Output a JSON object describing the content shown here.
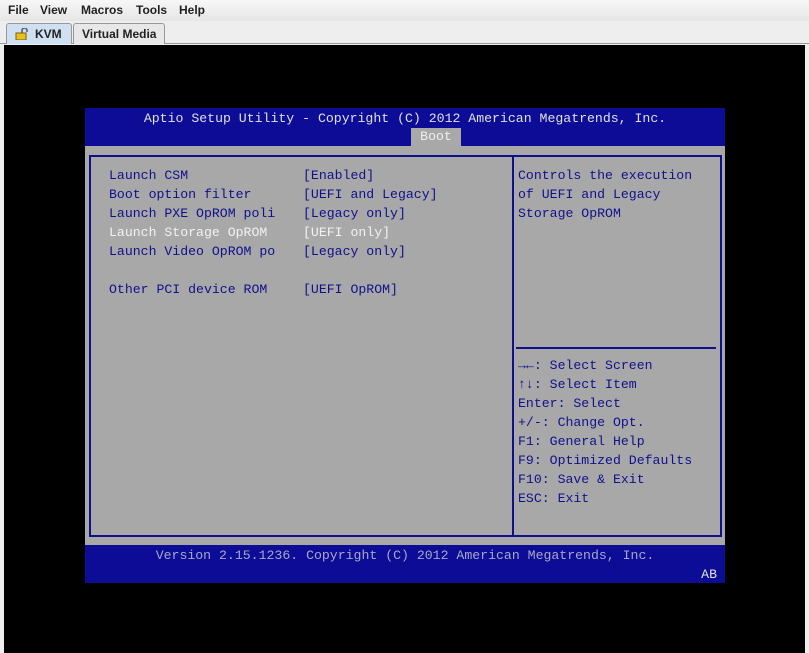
{
  "menu": [
    "File",
    "View",
    "Macros",
    "Tools",
    "Help"
  ],
  "tabs": {
    "kvm": "KVM",
    "virtual_media": "Virtual Media"
  },
  "bios": {
    "title": "Aptio Setup Utility - Copyright (C) 2012 American Megatrends, Inc.",
    "active_tab": "Boot",
    "settings": [
      {
        "label": "Launch CSM",
        "value": "[Enabled]"
      },
      {
        "label": "Boot option filter",
        "value": "[UEFI and Legacy]"
      },
      {
        "label": "Launch PXE OpROM poli",
        "value": "[Legacy only]"
      },
      {
        "label": "Launch Storage OpROM",
        "value": "[UEFI only]"
      },
      {
        "label": "Launch Video OpROM po",
        "value": "[Legacy only]"
      },
      {
        "label": "Other PCI device ROM",
        "value": "[UEFI OpROM]"
      }
    ],
    "help_text": [
      "Controls the execution",
      "of UEFI and Legacy",
      "Storage OpROM"
    ],
    "keys": [
      "→←: Select Screen",
      "↑↓: Select Item",
      "Enter: Select",
      "+/-: Change Opt.",
      "F1: General Help",
      "F9: Optimized Defaults",
      "F10: Save & Exit",
      "ESC: Exit"
    ],
    "version": "Version 2.15.1236. Copyright (C) 2012 American Megatrends, Inc.",
    "indicator": "AB"
  }
}
